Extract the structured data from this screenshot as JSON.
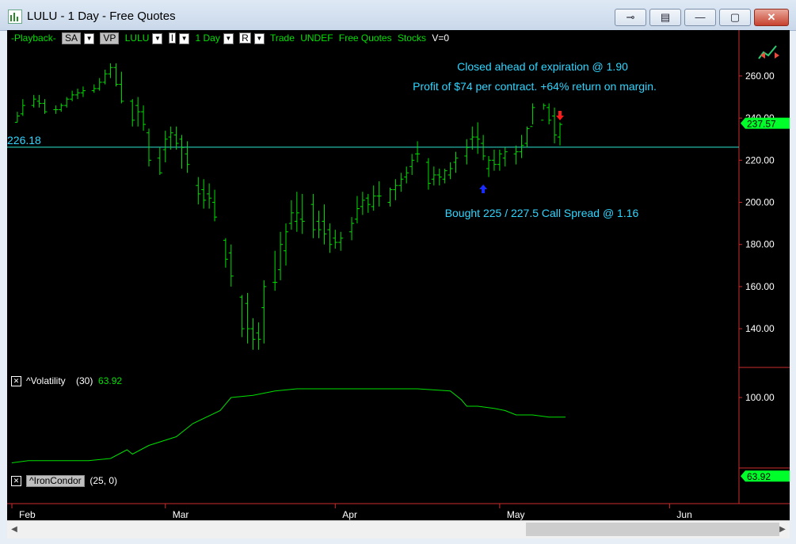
{
  "window": {
    "title": "LULU - 1 Day - Free Quotes",
    "minimize_symbol": "—",
    "maximize_symbol": "▢",
    "close_symbol": "✕"
  },
  "toolbar": {
    "playback": "-Playback-",
    "sa": "SA",
    "vp": "VP",
    "symbol": "LULU",
    "i_box": "I",
    "interval": "1 Day",
    "r_box": "R",
    "mode": "Trade",
    "account": "UNDEF",
    "feed": "Free Quotes",
    "type": "Stocks",
    "version": "V=0"
  },
  "colors": {
    "bars": "#00e000",
    "cyan_text": "#2fd6ff",
    "hline": "#2fe6d6",
    "axis": "#cc2b2b",
    "price_tag": "#00ff2a",
    "sell_arrow": "#ff1a1a",
    "buy_arrow": "#1a2cff"
  },
  "annotations": {
    "closed": "Closed ahead of expiration @ 1.90",
    "profit": "Profit of $74 per contract. +64% return on margin.",
    "bought": "Bought 225 / 227.5 Call Spread @ 1.16",
    "hline_label": "226.18"
  },
  "price_tag": "237.57",
  "volatility": {
    "label": "^Volatility",
    "params": "(30)",
    "value": "63.92",
    "tag": "63.92",
    "y_ticks": [
      "100.00"
    ]
  },
  "iron_condor": {
    "label": "^IronCondor",
    "params": "(25,  0)"
  },
  "chart_data": {
    "type": "bar",
    "symbol": "LULU",
    "ylim": [
      122,
      272
    ],
    "y_ticks": [
      "260.00",
      "240.00",
      "220.00",
      "200.00",
      "180.00",
      "160.00",
      "140.00"
    ],
    "x_labels": [
      "Feb",
      "Mar",
      "Apr",
      "May",
      "Jun"
    ],
    "x_label_days": [
      0,
      28,
      59,
      89,
      120
    ],
    "hline": 226.18,
    "buy_day": 86,
    "sell_day": 100,
    "ohlc": [
      [
        1,
        238,
        243,
        238,
        241
      ],
      [
        2,
        242,
        249,
        241,
        246
      ],
      [
        4,
        246,
        251,
        245,
        249
      ],
      [
        5,
        248,
        251,
        245,
        247
      ],
      [
        6,
        247,
        249,
        242,
        243
      ],
      [
        8,
        244,
        246,
        242,
        244
      ],
      [
        9,
        244,
        247,
        243,
        246
      ],
      [
        10,
        246,
        250,
        245,
        249
      ],
      [
        11,
        249,
        253,
        248,
        251
      ],
      [
        12,
        251,
        254,
        249,
        252
      ],
      [
        13,
        252,
        255,
        250,
        253
      ],
      [
        15,
        253,
        256,
        252,
        254
      ],
      [
        16,
        254,
        259,
        253,
        257
      ],
      [
        17,
        257,
        263,
        256,
        261
      ],
      [
        18,
        261,
        266,
        259,
        264
      ],
      [
        19,
        264,
        266,
        255,
        256
      ],
      [
        20,
        256,
        262,
        247,
        248
      ],
      [
        22,
        248,
        249,
        236,
        239
      ],
      [
        23,
        246,
        250,
        236,
        243
      ],
      [
        24,
        243,
        246,
        234,
        237
      ],
      [
        25,
        233,
        235,
        217,
        220
      ],
      [
        27,
        221,
        226,
        213,
        214
      ],
      [
        28,
        225,
        234,
        219,
        230
      ],
      [
        29,
        231,
        236,
        225,
        233
      ],
      [
        30,
        232,
        236,
        225,
        228
      ],
      [
        31,
        230,
        232,
        216,
        226
      ],
      [
        32,
        223,
        229,
        214,
        218
      ],
      [
        34,
        208,
        212,
        199,
        204
      ],
      [
        35,
        206,
        211,
        197,
        201
      ],
      [
        36,
        204,
        209,
        197,
        202
      ],
      [
        37,
        200,
        206,
        191,
        193
      ],
      [
        39,
        182,
        183,
        169,
        173
      ],
      [
        40,
        176,
        180,
        160,
        165
      ],
      [
        42,
        155,
        156,
        136,
        140
      ],
      [
        43,
        152,
        157,
        133,
        140
      ],
      [
        44,
        140,
        145,
        130,
        135
      ],
      [
        45,
        138,
        143,
        130,
        135
      ],
      [
        46,
        150,
        163,
        133,
        160
      ],
      [
        48,
        162,
        177,
        158,
        162
      ],
      [
        49,
        168,
        186,
        163,
        180
      ],
      [
        50,
        177,
        190,
        170,
        186
      ],
      [
        51,
        190,
        201,
        187,
        195
      ],
      [
        52,
        191,
        205,
        186,
        195
      ],
      [
        53,
        192,
        204,
        185,
        191
      ],
      [
        55,
        199,
        204,
        183,
        187
      ],
      [
        56,
        191,
        196,
        183,
        187
      ],
      [
        57,
        191,
        199,
        180,
        185
      ],
      [
        58,
        187,
        190,
        176,
        180
      ],
      [
        59,
        183,
        187,
        178,
        181
      ],
      [
        60,
        181,
        186,
        177,
        183
      ],
      [
        62,
        186,
        193,
        182,
        190
      ],
      [
        63,
        192,
        203,
        190,
        197
      ],
      [
        64,
        198,
        205,
        194,
        201
      ],
      [
        65,
        202,
        204,
        195,
        199
      ],
      [
        66,
        198,
        208,
        196,
        203
      ],
      [
        67,
        203,
        210,
        198,
        203
      ],
      [
        69,
        200,
        207,
        198,
        206
      ],
      [
        70,
        206,
        211,
        201,
        208
      ],
      [
        71,
        208,
        214,
        205,
        211
      ],
      [
        72,
        212,
        217,
        209,
        214
      ],
      [
        73,
        217,
        223,
        213,
        220
      ],
      [
        74,
        223,
        229,
        219,
        223
      ],
      [
        76,
        219,
        221,
        206,
        209
      ],
      [
        77,
        211,
        217,
        208,
        213
      ],
      [
        78,
        213,
        216,
        208,
        212
      ],
      [
        79,
        211,
        216,
        209,
        215
      ],
      [
        80,
        213,
        219,
        211,
        216
      ],
      [
        81,
        219,
        224,
        214,
        221
      ],
      [
        83,
        222,
        230,
        218,
        226
      ],
      [
        84,
        230,
        236,
        225,
        231
      ],
      [
        85,
        231,
        238,
        223,
        230
      ],
      [
        86,
        228,
        232,
        220,
        222
      ],
      [
        87,
        216,
        222,
        212,
        220
      ],
      [
        88,
        220,
        225,
        215,
        218
      ],
      [
        89,
        218,
        225,
        215,
        223
      ],
      [
        90,
        221,
        226,
        217,
        224
      ],
      [
        92,
        223,
        227,
        218,
        224
      ],
      [
        93,
        224,
        232,
        221,
        227
      ],
      [
        94,
        228,
        236,
        226,
        235
      ],
      [
        95,
        236,
        247,
        237,
        245
      ],
      [
        97,
        239,
        247,
        244,
        246
      ],
      [
        98,
        245,
        247,
        237,
        239
      ],
      [
        99,
        241,
        245,
        228,
        232
      ],
      [
        100,
        231,
        238,
        227,
        237
      ]
    ]
  },
  "volatility_data": {
    "ylim": [
      68,
      108
    ],
    "points": [
      [
        0,
        70
      ],
      [
        3,
        71
      ],
      [
        8,
        71
      ],
      [
        14,
        71
      ],
      [
        18,
        72
      ],
      [
        21,
        76
      ],
      [
        22,
        74
      ],
      [
        25,
        78
      ],
      [
        30,
        82
      ],
      [
        33,
        88
      ],
      [
        38,
        94
      ],
      [
        40,
        100
      ],
      [
        44,
        101
      ],
      [
        48,
        103
      ],
      [
        52,
        104
      ],
      [
        60,
        104
      ],
      [
        66,
        104
      ],
      [
        74,
        104
      ],
      [
        80,
        103
      ],
      [
        82,
        99
      ],
      [
        83,
        96
      ],
      [
        85,
        96
      ],
      [
        88,
        95
      ],
      [
        90,
        94
      ],
      [
        92,
        92
      ],
      [
        95,
        92
      ],
      [
        98,
        91
      ],
      [
        101,
        91
      ]
    ]
  }
}
